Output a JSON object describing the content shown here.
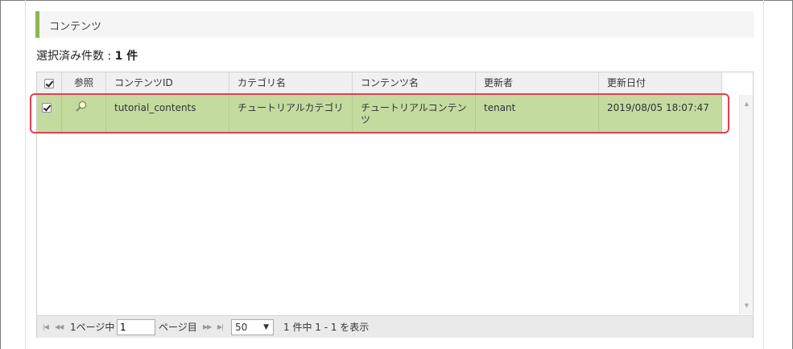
{
  "section": {
    "title": "コンテンツ"
  },
  "selected": {
    "label": "選択済み件数 : ",
    "count": "1 件"
  },
  "grid": {
    "columns": [
      "参照",
      "コンテンツID",
      "カテゴリ名",
      "コンテンツ名",
      "更新者",
      "更新日付"
    ],
    "rows": [
      {
        "checked": true,
        "content_id": "tutorial_contents",
        "category_name": "チュートリアルカテゴリ",
        "content_name": "チュートリアルコンテンツ",
        "updated_by": "tenant",
        "updated_at": "2019/08/05 18:07:47"
      }
    ]
  },
  "pager": {
    "first_icon": "first-page-icon",
    "prev_icon": "prev-page-icon",
    "page_prefix": "1ページ中",
    "page_value": "1",
    "page_suffix": "ページ目",
    "next_icon": "next-page-icon",
    "last_icon": "last-page-icon",
    "page_size": "50",
    "summary": "1 件中 1 - 1 を表示"
  },
  "colors": {
    "accent": "#8db554",
    "selected_row": "#c4dba0",
    "highlight": "#e04050"
  }
}
